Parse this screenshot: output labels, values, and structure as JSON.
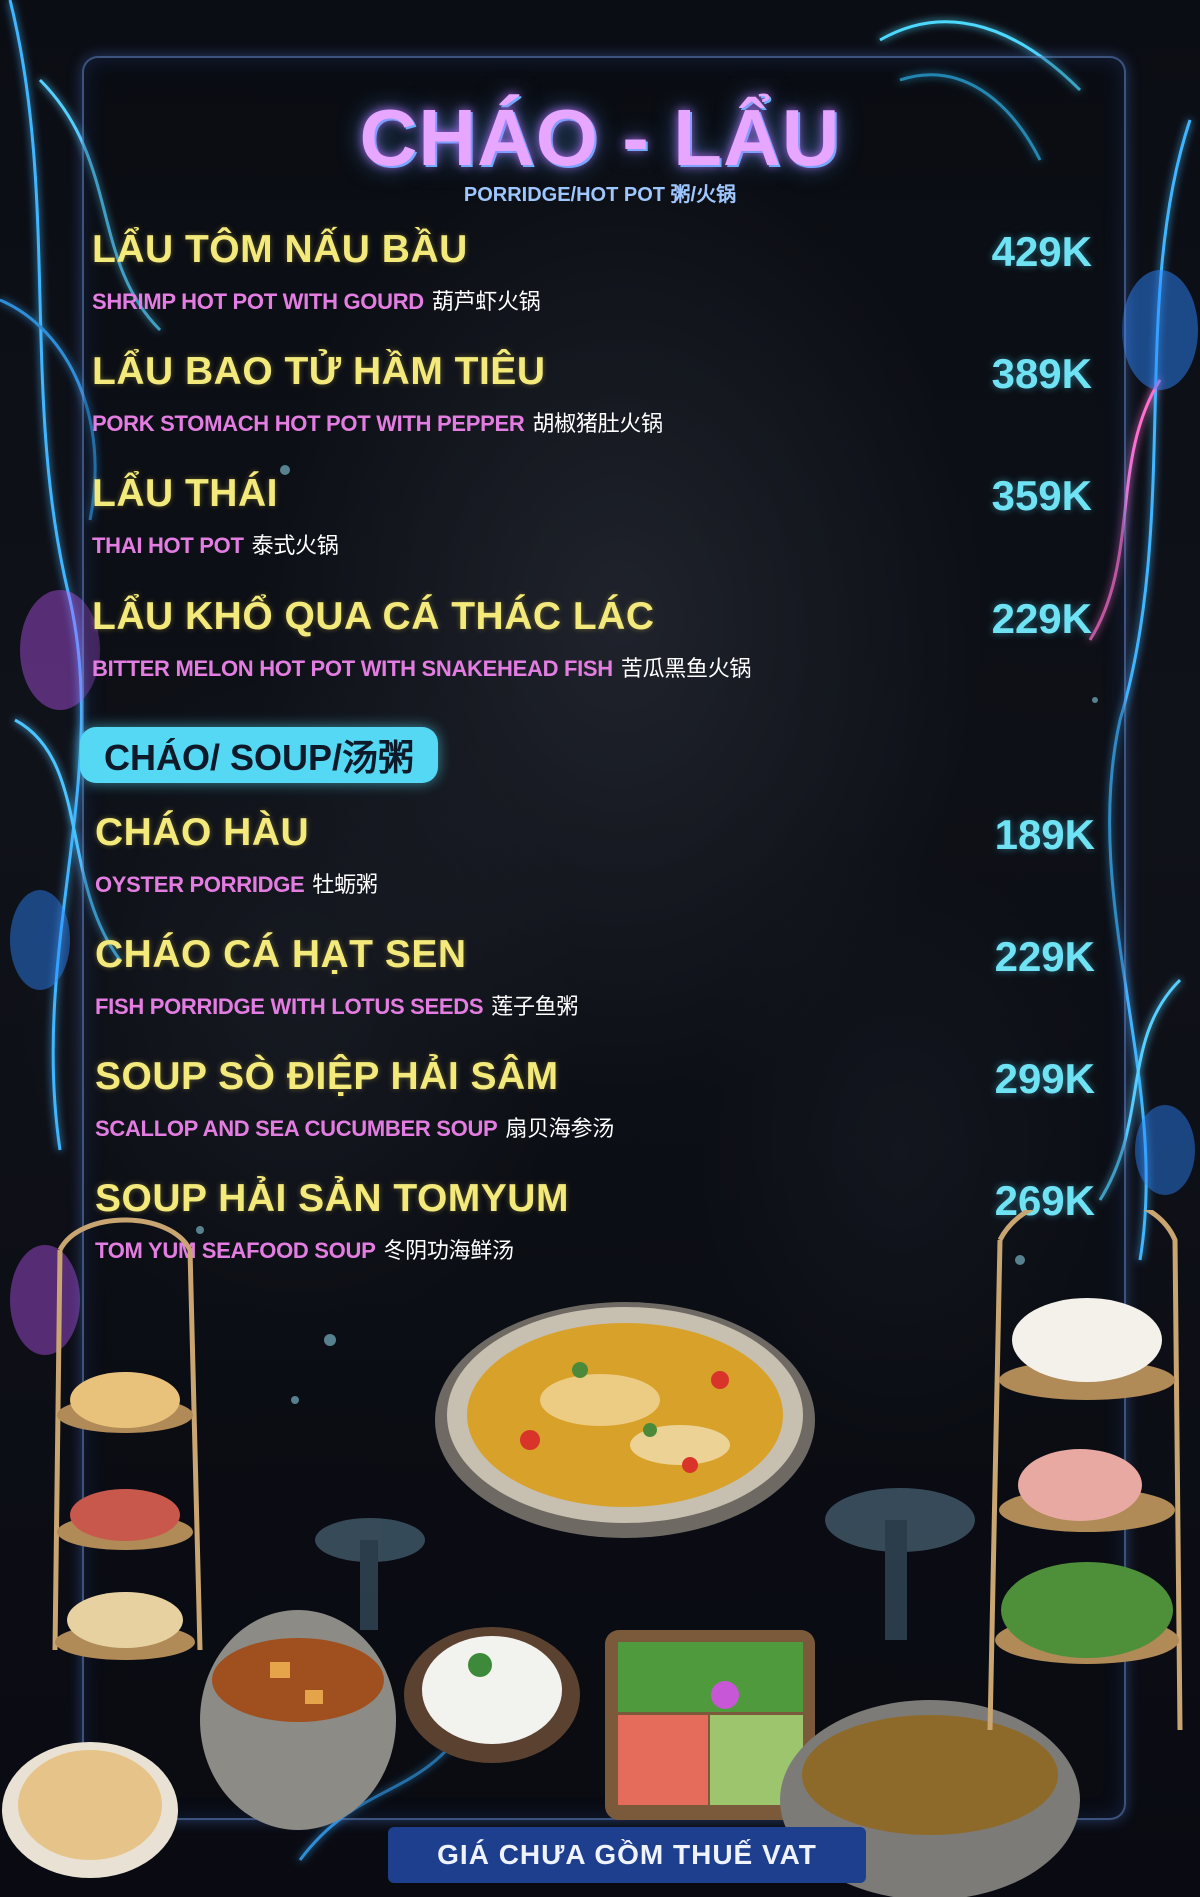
{
  "header": {
    "title": "CHÁO - LẨU",
    "subtitle": "PORRIDGE/HOT POT 粥/火锅"
  },
  "hotpot_items": [
    {
      "name": "LẨU TÔM NẤU  BẦU",
      "desc_en": "SHRIMP HOT POT WITH GOURD",
      "desc_zh": "葫芦虾火锅",
      "price": "429K"
    },
    {
      "name": "LẨU BAO TỬ HẦM TIÊU",
      "desc_en": "PORK STOMACH HOT POT WITH PEPPER",
      "desc_zh": "胡椒猪肚火锅",
      "price": "389K"
    },
    {
      "name": "LẨU THÁI",
      "desc_en": "THAI HOT POT",
      "desc_zh": "泰式火锅",
      "price": "359K"
    },
    {
      "name": "LẨU  KHỔ QUA CÁ THÁC LÁC",
      "desc_en": "BITTER MELON HOT POT WITH SNAKEHEAD FISH",
      "desc_zh": "苦瓜黑鱼火锅",
      "price": "229K"
    }
  ],
  "soup_section": {
    "label": "CHÁO/ SOUP/汤粥"
  },
  "soup_items": [
    {
      "name": "CHÁO HÀU",
      "desc_en": "OYSTER PORRIDGE",
      "desc_zh": "牡蛎粥",
      "price": "189K"
    },
    {
      "name": "CHÁO CÁ  HẠT SEN",
      "desc_en": "FISH PORRIDGE WITH LOTUS SEEDS",
      "desc_zh": "莲子鱼粥",
      "price": "229K"
    },
    {
      "name": "SOUP SÒ ĐIỆP HẢI SÂM",
      "desc_en": "SCALLOP AND SEA CUCUMBER SOUP",
      "desc_zh": "扇贝海参汤",
      "price": "299K"
    },
    {
      "name": "SOUP HẢI SẢN TOMYUM",
      "desc_en": "TOM YUM SEAFOOD SOUP",
      "desc_zh": "冬阴功海鲜汤",
      "price": "269K"
    }
  ],
  "footer": {
    "note": "GIÁ CHƯA GỒM THUẾ VAT"
  },
  "colors": {
    "title": "#e7a6ff",
    "item_name": "#f4ea7c",
    "item_desc": "#e47de2",
    "price": "#6fe3f4",
    "section_pill": "#54d8f4",
    "footer_bg": "#1e3f8e"
  },
  "decor": {
    "background": "dark-stone-texture",
    "border": "neon-jungle-foliage",
    "photos": [
      "hot-pot-bowl-photo",
      "shrimp-tray-photo",
      "rice-bowl-photo",
      "vegetable-platter-photo",
      "noodle-rack-photo",
      "pot-photo"
    ]
  }
}
